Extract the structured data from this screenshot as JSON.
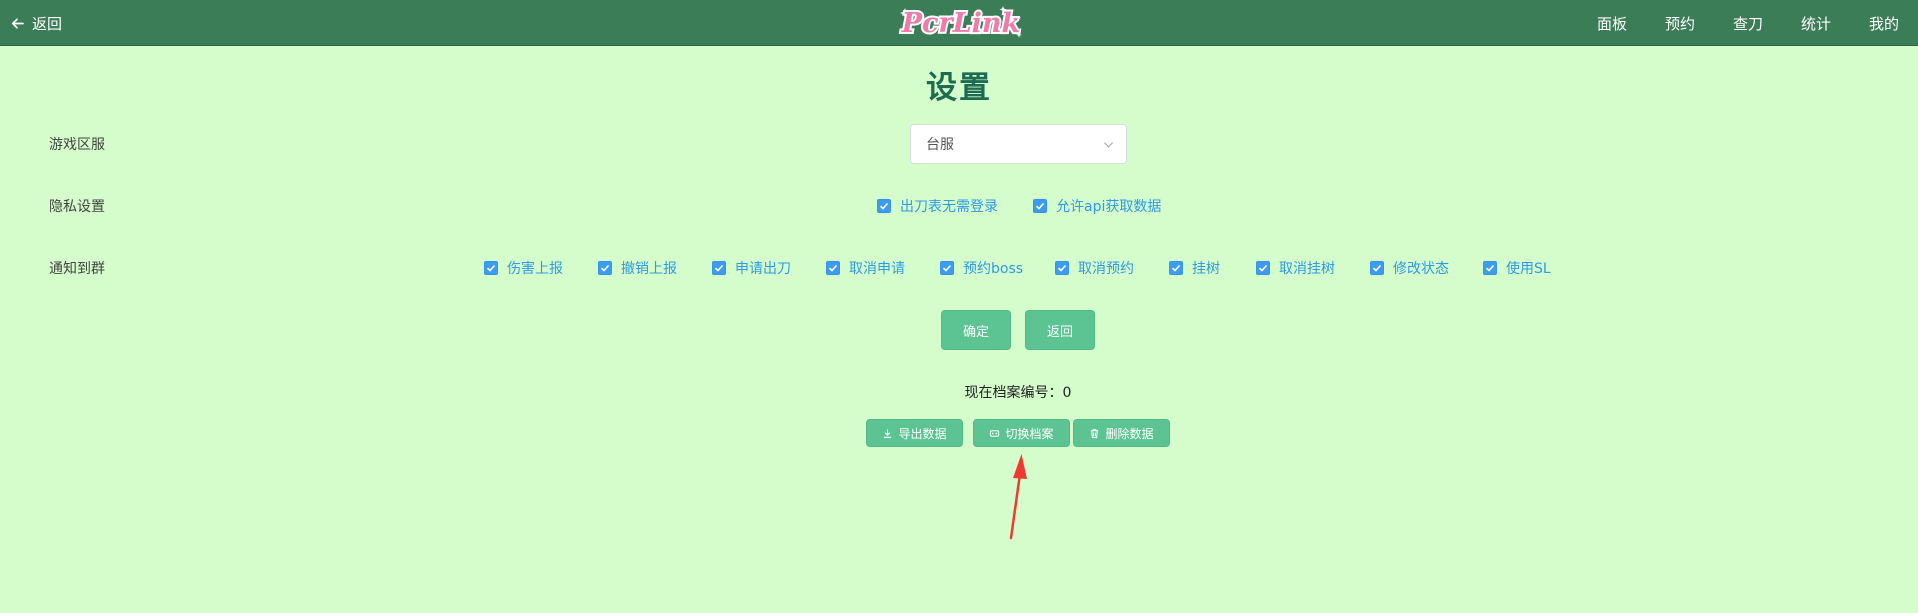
{
  "header": {
    "back_label": "返回",
    "logo_text": "PcrLink",
    "nav": [
      "面板",
      "预约",
      "查刀",
      "统计",
      "我的"
    ],
    "bg_color": "#3a7d56"
  },
  "title": "设置",
  "server": {
    "label": "游戏区服",
    "selected": "台服"
  },
  "privacy": {
    "label": "隐私设置",
    "options": [
      {
        "label": "出刀表无需登录",
        "checked": true
      },
      {
        "label": "允许api获取数据",
        "checked": true
      }
    ]
  },
  "notify": {
    "label": "通知到群",
    "options": [
      {
        "label": "伤害上报",
        "checked": true
      },
      {
        "label": "撤销上报",
        "checked": true
      },
      {
        "label": "申请出刀",
        "checked": true
      },
      {
        "label": "取消申请",
        "checked": true
      },
      {
        "label": "预约boss",
        "checked": true
      },
      {
        "label": "取消预约",
        "checked": true
      },
      {
        "label": "挂树",
        "checked": true
      },
      {
        "label": "取消挂树",
        "checked": true
      },
      {
        "label": "修改状态",
        "checked": true
      },
      {
        "label": "使用SL",
        "checked": true
      }
    ]
  },
  "actions": {
    "confirm": "确定",
    "back": "返回"
  },
  "archive": {
    "current_label": "现在档案编号：0",
    "export": "导出数据",
    "switch": "切换档案",
    "delete": "删除数据"
  },
  "colors": {
    "page_bg": "#d5fdcc",
    "accent_green": "#5cc493",
    "checkbox_blue": "#3e9cf0",
    "title_green": "#1d6b52",
    "annotation_red": "#ee3a2f"
  }
}
